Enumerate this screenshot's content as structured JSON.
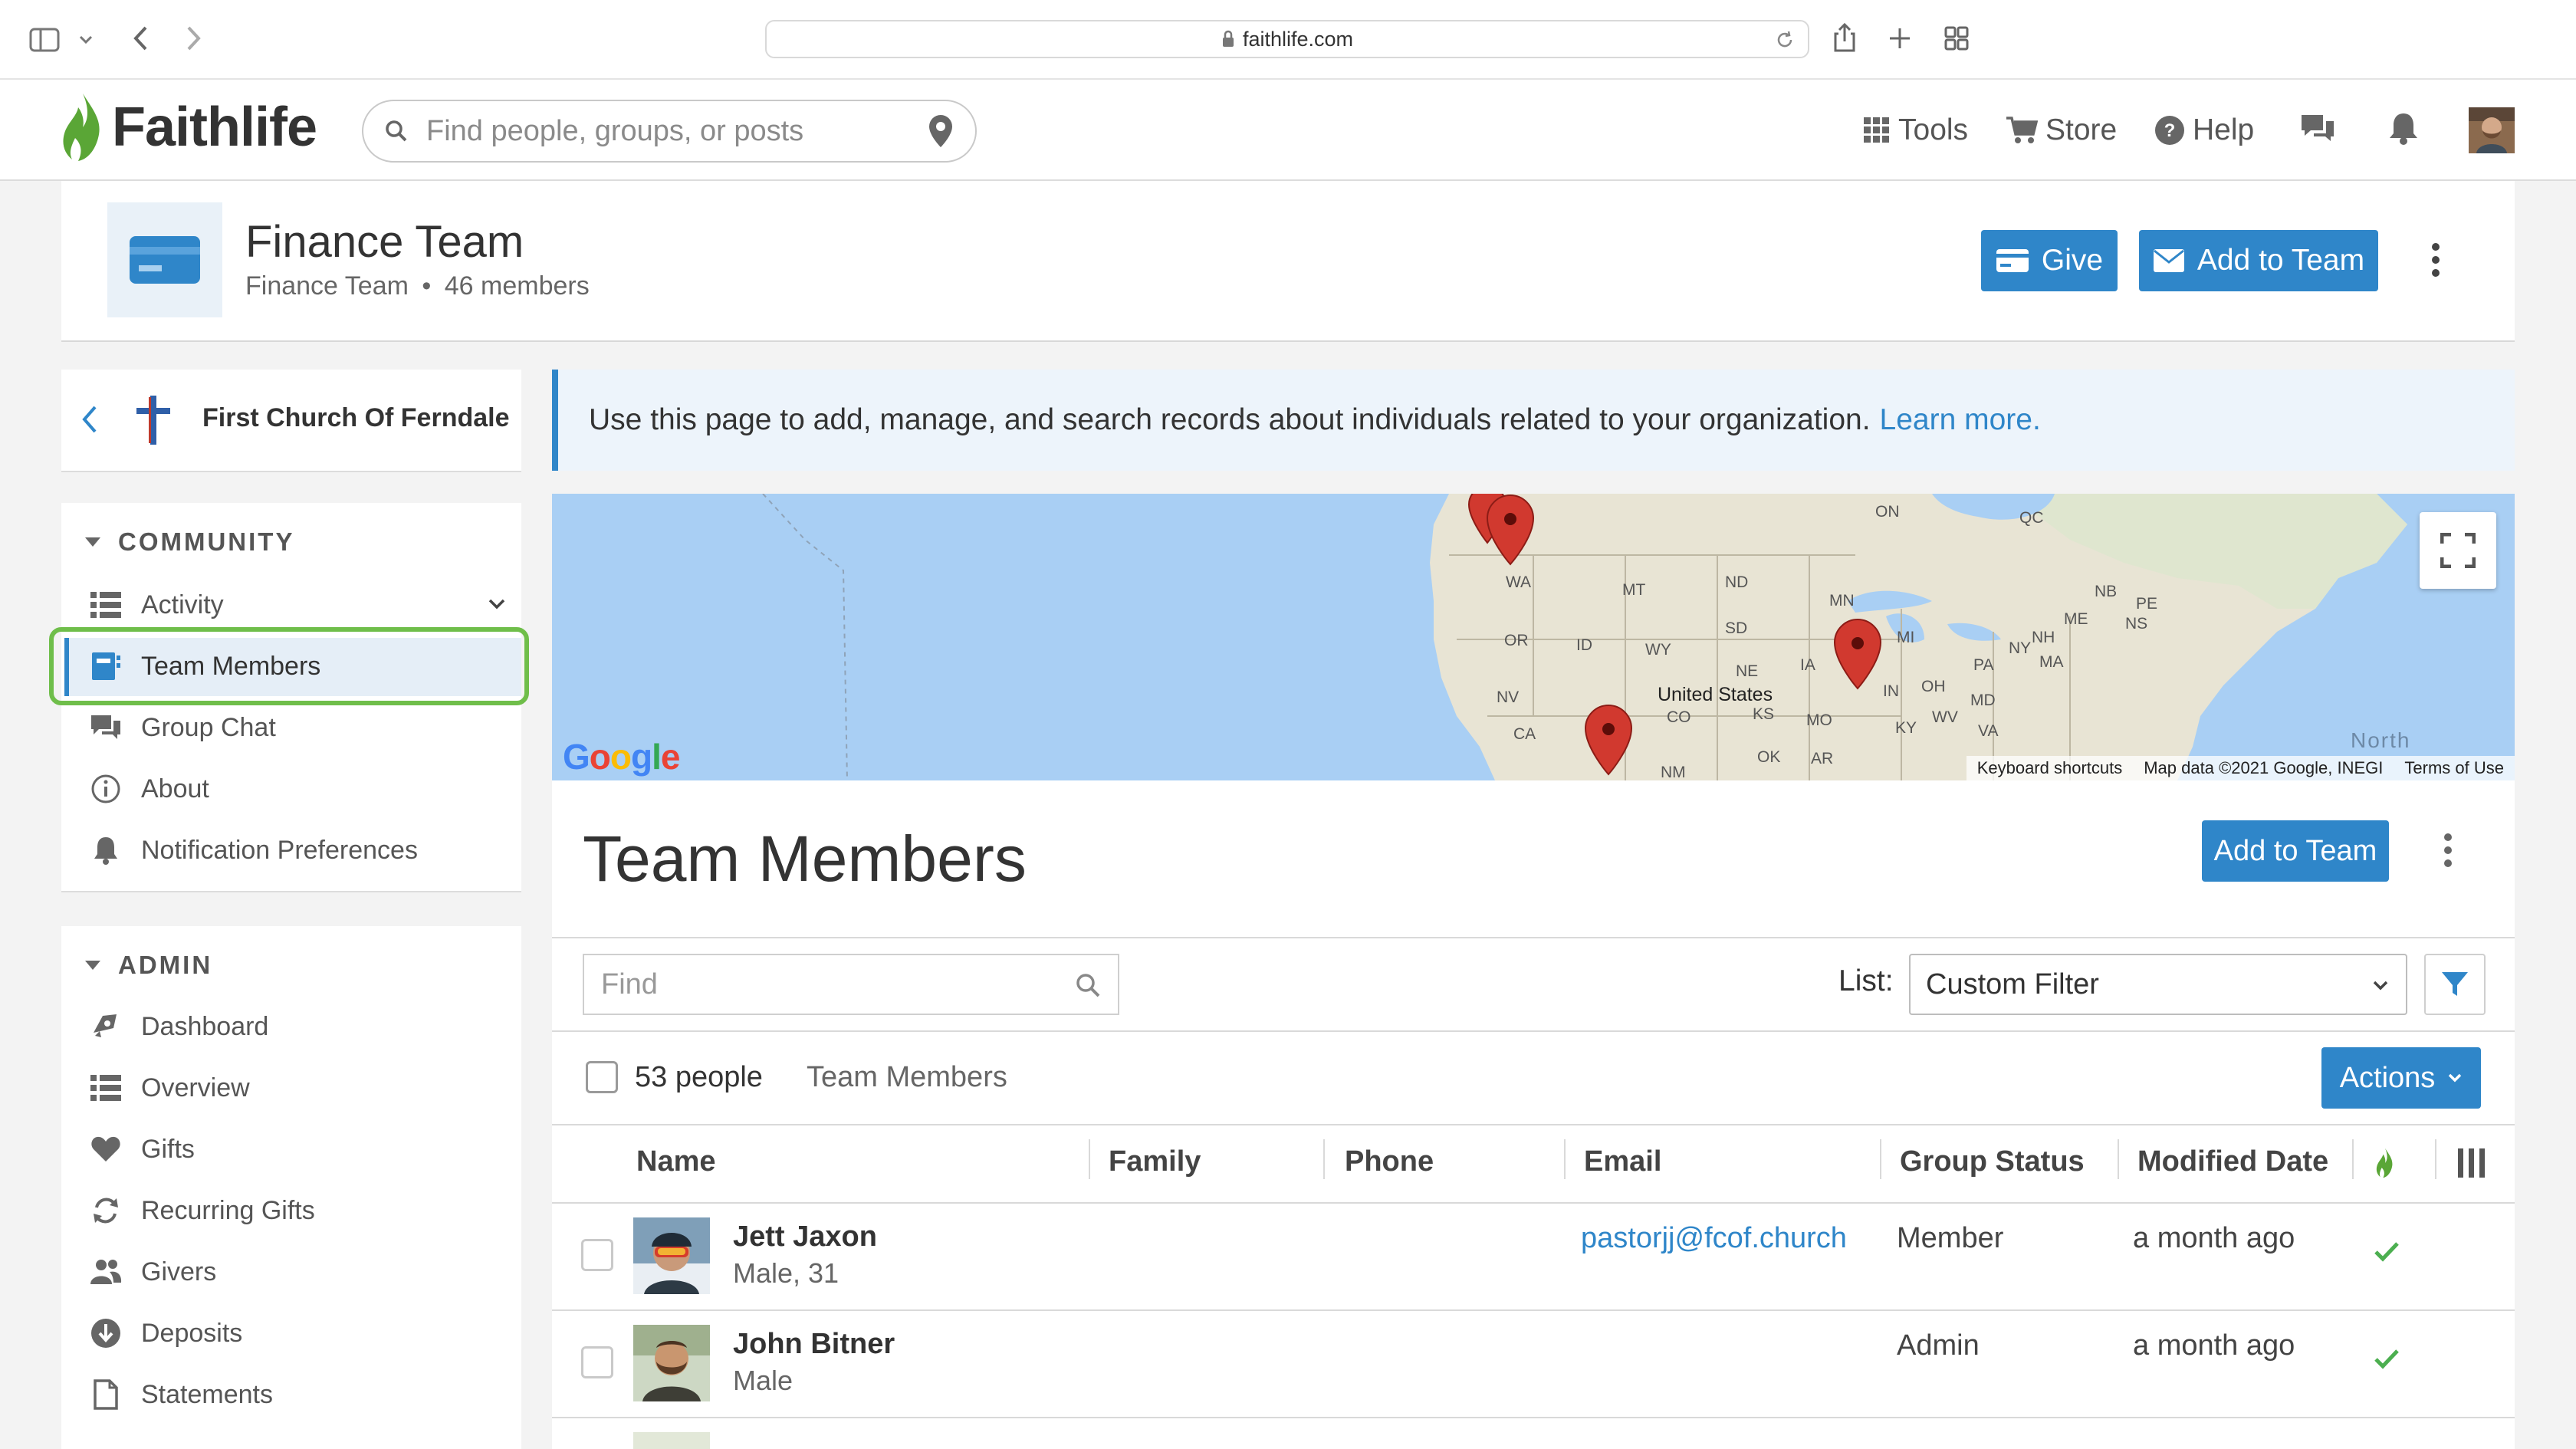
{
  "browser": {
    "url": "faithlife.com"
  },
  "site": {
    "brand": "Faithlife",
    "search_placeholder": "Find people, groups, or posts",
    "nav": {
      "tools": "Tools",
      "store": "Store",
      "help": "Help"
    }
  },
  "group": {
    "title": "Finance Team",
    "subtitle_name": "Finance Team",
    "separator": "•",
    "member_count": "46 members",
    "give_label": "Give",
    "add_label": "Add to Team"
  },
  "sidebar": {
    "church_name": "First Church Of Ferndale",
    "community_heading": "COMMUNITY",
    "community_items": [
      {
        "label": "Activity",
        "icon": "activity-list-icon"
      },
      {
        "label": "Team Members",
        "icon": "contact-card-icon",
        "active": true
      },
      {
        "label": "Group Chat",
        "icon": "chat-bubbles-icon"
      },
      {
        "label": "About",
        "icon": "info-icon"
      },
      {
        "label": "Notification Preferences",
        "icon": "bell-icon"
      }
    ],
    "admin_heading": "ADMIN",
    "admin_items": [
      {
        "label": "Dashboard",
        "icon": "dashboard-icon"
      },
      {
        "label": "Overview",
        "icon": "overview-list-icon"
      },
      {
        "label": "Gifts",
        "icon": "heart-icon"
      },
      {
        "label": "Recurring Gifts",
        "icon": "recurring-icon"
      },
      {
        "label": "Givers",
        "icon": "people-icon"
      },
      {
        "label": "Deposits",
        "icon": "deposit-icon"
      },
      {
        "label": "Statements",
        "icon": "document-icon"
      }
    ]
  },
  "banner": {
    "text": "Use this page to add, manage, and search records about individuals related to your organization.",
    "link": "Learn more."
  },
  "map": {
    "labels": [
      "ON",
      "QC",
      "WA",
      "MT",
      "ND",
      "MN",
      "NB",
      "PE",
      "ME",
      "NS",
      "OR",
      "ID",
      "SD",
      "WY",
      "MI",
      "NH",
      "NY",
      "MA",
      "NE",
      "IA",
      "PA",
      "NV",
      "United States",
      "OH",
      "IN",
      "MD",
      "KS",
      "MO",
      "WV",
      "CO",
      "VA",
      "KY",
      "CA",
      "OK",
      "AR",
      "NM",
      "North"
    ],
    "attribution": {
      "google": "Google",
      "shortcuts": "Keyboard shortcuts",
      "data": "Map data ©2021 Google, INEGI",
      "terms": "Terms of Use"
    }
  },
  "members": {
    "title": "Team Members",
    "add_label": "Add to Team",
    "find_placeholder": "Find",
    "list_label": "List:",
    "list_value": "Custom Filter",
    "people_count": "53 people",
    "list_name": "Team Members",
    "actions_label": "Actions",
    "columns": [
      "Name",
      "Family",
      "Phone",
      "Email",
      "Group Status",
      "Modified Date"
    ],
    "rows": [
      {
        "name": "Jett Jaxon",
        "sub": "Male, 31",
        "email": "pastorjj@fcof.church",
        "status": "Member",
        "modified": "a month ago"
      },
      {
        "name": "John Bitner",
        "sub": "Male",
        "email": "",
        "status": "Admin",
        "modified": "a month ago"
      }
    ]
  },
  "colors": {
    "accent": "#2f86c9",
    "highlight": "#6fbe4a",
    "check": "#4caf50"
  }
}
